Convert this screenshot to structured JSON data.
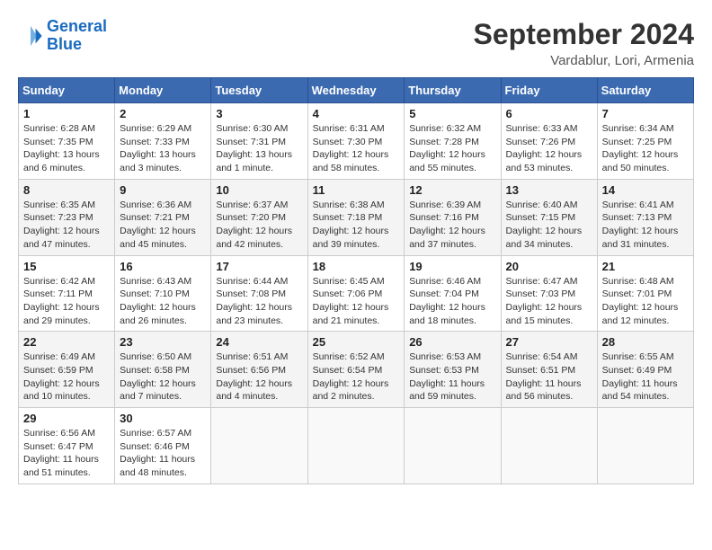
{
  "logo": {
    "line1": "General",
    "line2": "Blue"
  },
  "title": "September 2024",
  "location": "Vardablur, Lori, Armenia",
  "headers": [
    "Sunday",
    "Monday",
    "Tuesday",
    "Wednesday",
    "Thursday",
    "Friday",
    "Saturday"
  ],
  "weeks": [
    [
      {
        "day": "1",
        "sunrise": "Sunrise: 6:28 AM",
        "sunset": "Sunset: 7:35 PM",
        "daylight": "Daylight: 13 hours and 6 minutes."
      },
      {
        "day": "2",
        "sunrise": "Sunrise: 6:29 AM",
        "sunset": "Sunset: 7:33 PM",
        "daylight": "Daylight: 13 hours and 3 minutes."
      },
      {
        "day": "3",
        "sunrise": "Sunrise: 6:30 AM",
        "sunset": "Sunset: 7:31 PM",
        "daylight": "Daylight: 13 hours and 1 minute."
      },
      {
        "day": "4",
        "sunrise": "Sunrise: 6:31 AM",
        "sunset": "Sunset: 7:30 PM",
        "daylight": "Daylight: 12 hours and 58 minutes."
      },
      {
        "day": "5",
        "sunrise": "Sunrise: 6:32 AM",
        "sunset": "Sunset: 7:28 PM",
        "daylight": "Daylight: 12 hours and 55 minutes."
      },
      {
        "day": "6",
        "sunrise": "Sunrise: 6:33 AM",
        "sunset": "Sunset: 7:26 PM",
        "daylight": "Daylight: 12 hours and 53 minutes."
      },
      {
        "day": "7",
        "sunrise": "Sunrise: 6:34 AM",
        "sunset": "Sunset: 7:25 PM",
        "daylight": "Daylight: 12 hours and 50 minutes."
      }
    ],
    [
      {
        "day": "8",
        "sunrise": "Sunrise: 6:35 AM",
        "sunset": "Sunset: 7:23 PM",
        "daylight": "Daylight: 12 hours and 47 minutes."
      },
      {
        "day": "9",
        "sunrise": "Sunrise: 6:36 AM",
        "sunset": "Sunset: 7:21 PM",
        "daylight": "Daylight: 12 hours and 45 minutes."
      },
      {
        "day": "10",
        "sunrise": "Sunrise: 6:37 AM",
        "sunset": "Sunset: 7:20 PM",
        "daylight": "Daylight: 12 hours and 42 minutes."
      },
      {
        "day": "11",
        "sunrise": "Sunrise: 6:38 AM",
        "sunset": "Sunset: 7:18 PM",
        "daylight": "Daylight: 12 hours and 39 minutes."
      },
      {
        "day": "12",
        "sunrise": "Sunrise: 6:39 AM",
        "sunset": "Sunset: 7:16 PM",
        "daylight": "Daylight: 12 hours and 37 minutes."
      },
      {
        "day": "13",
        "sunrise": "Sunrise: 6:40 AM",
        "sunset": "Sunset: 7:15 PM",
        "daylight": "Daylight: 12 hours and 34 minutes."
      },
      {
        "day": "14",
        "sunrise": "Sunrise: 6:41 AM",
        "sunset": "Sunset: 7:13 PM",
        "daylight": "Daylight: 12 hours and 31 minutes."
      }
    ],
    [
      {
        "day": "15",
        "sunrise": "Sunrise: 6:42 AM",
        "sunset": "Sunset: 7:11 PM",
        "daylight": "Daylight: 12 hours and 29 minutes."
      },
      {
        "day": "16",
        "sunrise": "Sunrise: 6:43 AM",
        "sunset": "Sunset: 7:10 PM",
        "daylight": "Daylight: 12 hours and 26 minutes."
      },
      {
        "day": "17",
        "sunrise": "Sunrise: 6:44 AM",
        "sunset": "Sunset: 7:08 PM",
        "daylight": "Daylight: 12 hours and 23 minutes."
      },
      {
        "day": "18",
        "sunrise": "Sunrise: 6:45 AM",
        "sunset": "Sunset: 7:06 PM",
        "daylight": "Daylight: 12 hours and 21 minutes."
      },
      {
        "day": "19",
        "sunrise": "Sunrise: 6:46 AM",
        "sunset": "Sunset: 7:04 PM",
        "daylight": "Daylight: 12 hours and 18 minutes."
      },
      {
        "day": "20",
        "sunrise": "Sunrise: 6:47 AM",
        "sunset": "Sunset: 7:03 PM",
        "daylight": "Daylight: 12 hours and 15 minutes."
      },
      {
        "day": "21",
        "sunrise": "Sunrise: 6:48 AM",
        "sunset": "Sunset: 7:01 PM",
        "daylight": "Daylight: 12 hours and 12 minutes."
      }
    ],
    [
      {
        "day": "22",
        "sunrise": "Sunrise: 6:49 AM",
        "sunset": "Sunset: 6:59 PM",
        "daylight": "Daylight: 12 hours and 10 minutes."
      },
      {
        "day": "23",
        "sunrise": "Sunrise: 6:50 AM",
        "sunset": "Sunset: 6:58 PM",
        "daylight": "Daylight: 12 hours and 7 minutes."
      },
      {
        "day": "24",
        "sunrise": "Sunrise: 6:51 AM",
        "sunset": "Sunset: 6:56 PM",
        "daylight": "Daylight: 12 hours and 4 minutes."
      },
      {
        "day": "25",
        "sunrise": "Sunrise: 6:52 AM",
        "sunset": "Sunset: 6:54 PM",
        "daylight": "Daylight: 12 hours and 2 minutes."
      },
      {
        "day": "26",
        "sunrise": "Sunrise: 6:53 AM",
        "sunset": "Sunset: 6:53 PM",
        "daylight": "Daylight: 11 hours and 59 minutes."
      },
      {
        "day": "27",
        "sunrise": "Sunrise: 6:54 AM",
        "sunset": "Sunset: 6:51 PM",
        "daylight": "Daylight: 11 hours and 56 minutes."
      },
      {
        "day": "28",
        "sunrise": "Sunrise: 6:55 AM",
        "sunset": "Sunset: 6:49 PM",
        "daylight": "Daylight: 11 hours and 54 minutes."
      }
    ],
    [
      {
        "day": "29",
        "sunrise": "Sunrise: 6:56 AM",
        "sunset": "Sunset: 6:47 PM",
        "daylight": "Daylight: 11 hours and 51 minutes."
      },
      {
        "day": "30",
        "sunrise": "Sunrise: 6:57 AM",
        "sunset": "Sunset: 6:46 PM",
        "daylight": "Daylight: 11 hours and 48 minutes."
      },
      null,
      null,
      null,
      null,
      null
    ]
  ]
}
